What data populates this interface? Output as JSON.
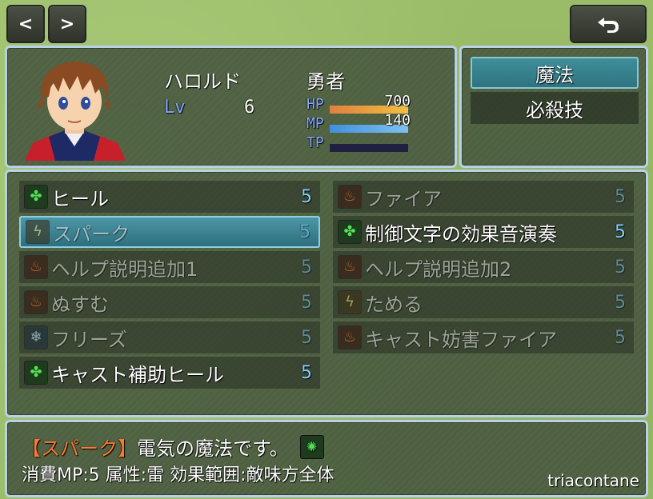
{
  "nav": {
    "prev_label": "<",
    "next_label": ">",
    "back_icon": "undo-arrow-icon"
  },
  "actor": {
    "name": "ハロルド",
    "class": "勇者",
    "lv_label": "Lv",
    "level": "6",
    "hp_label": "HP",
    "hp_value": "700",
    "hp_fraction": 1.0,
    "mp_label": "MP",
    "mp_value": "140",
    "mp_fraction": 1.0,
    "tp_label": "TP",
    "tp_value": "",
    "tp_fraction": 0.0
  },
  "skill_types": [
    {
      "label": "魔法",
      "selected": true
    },
    {
      "label": "必殺技",
      "selected": false
    }
  ],
  "skills": [
    {
      "name": "ヒール",
      "cost": "5",
      "icon": "clover-icon",
      "enabled": true,
      "selected": false
    },
    {
      "name": "ファイア",
      "cost": "5",
      "icon": "fire-icon",
      "enabled": false,
      "selected": false
    },
    {
      "name": "スパーク",
      "cost": "5",
      "icon": "spark-icon",
      "enabled": false,
      "selected": true
    },
    {
      "name": "制御文字の効果音演奏",
      "cost": "5",
      "icon": "clover-icon",
      "enabled": true,
      "selected": false
    },
    {
      "name": "ヘルプ説明追加1",
      "cost": "5",
      "icon": "fire-icon",
      "enabled": false,
      "selected": false
    },
    {
      "name": "ヘルプ説明追加2",
      "cost": "5",
      "icon": "fire-icon",
      "enabled": false,
      "selected": false
    },
    {
      "name": "ぬすむ",
      "cost": "5",
      "icon": "fire-icon",
      "enabled": false,
      "selected": false
    },
    {
      "name": "ためる",
      "cost": "5",
      "icon": "spark-icon",
      "enabled": false,
      "selected": false
    },
    {
      "name": "フリーズ",
      "cost": "5",
      "icon": "ice-icon",
      "enabled": false,
      "selected": false
    },
    {
      "name": "キャスト妨害ファイア",
      "cost": "5",
      "icon": "fire-icon",
      "enabled": false,
      "selected": false
    },
    {
      "name": "キャスト補助ヒール",
      "cost": "5",
      "icon": "clover-icon",
      "enabled": true,
      "selected": false
    }
  ],
  "help": {
    "skill_name": "【スパーク】",
    "description": "電気の魔法です。",
    "icon": "green-magic-icon",
    "details": "消費MP:5 属性:雷 効果範囲:敵味方全体"
  },
  "watermark": "triacontane",
  "colors": {
    "hp_gauge": "#e08040",
    "mp_gauge": "#4090e0",
    "tp_gauge": "#202040",
    "system_blue": "#84aaff",
    "cost_blue": "#84d0ff",
    "help_skill_color": "#ff7830"
  }
}
